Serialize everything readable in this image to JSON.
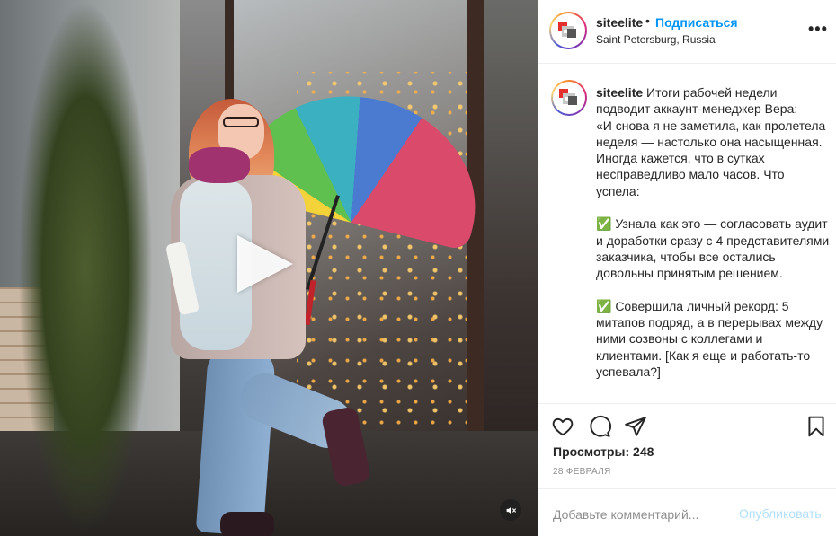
{
  "post": {
    "username": "siteelite",
    "separator": "•",
    "follow_label": "Подписаться",
    "location": "Saint Petersburg, Russia",
    "more_label": "•••",
    "caption_user": "siteelite",
    "caption_text": "Итоги рабочей недели подводит аккаунт-менеджер Вера:\n«И снова я не заметила, как пролетела неделя — настолько она насыщенная. Иногда кажется, что в сутках несправедливо мало часов. Что успела:\n\n✅ Узнала как это — согласовать аудит и доработки сразу с 4 представителями заказчика, чтобы все остались довольны принятым решением.\n\n✅ Совершила личный рекорд: 5 митапов подряд, а в перерывах между ними созвоны с коллегами и клиентами. [Как я еще и работать-то успевала?]",
    "views_label": "Просмотры: 248",
    "date": "28 ФЕВРАЛЯ"
  },
  "comment": {
    "placeholder": "Добавьте комментарий...",
    "publish_label": "Опубликовать"
  },
  "icons": {
    "like": "heart-icon",
    "comment": "comment-icon",
    "share": "share-icon",
    "save": "bookmark-icon",
    "play": "play-icon",
    "mute": "volume-mute-icon",
    "avatar": "siteelite-logo"
  },
  "colors": {
    "link_blue": "#0095f6",
    "publish_disabled": "#b2dffc",
    "muted_text": "#8e8e8e",
    "logo_red": "#e3302f"
  }
}
